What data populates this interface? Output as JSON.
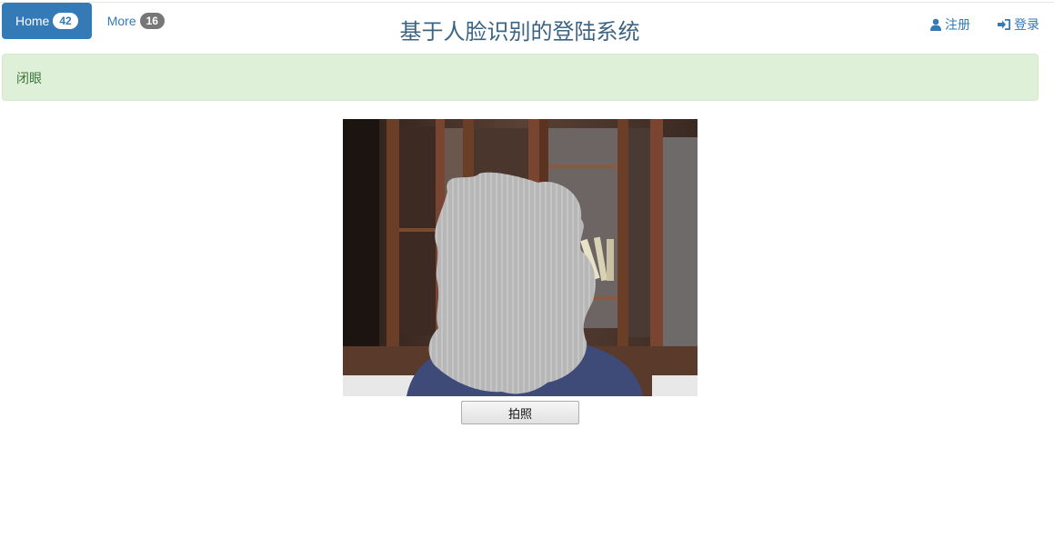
{
  "nav": {
    "items": [
      {
        "label": "Home",
        "badge": "42"
      },
      {
        "label": "More",
        "badge": "16"
      }
    ]
  },
  "header": {
    "title": "基于人脸识别的登陆系统"
  },
  "account_links": {
    "register": "注册",
    "login": "登录"
  },
  "alert": {
    "message": "闭眼"
  },
  "camera": {
    "capture_label": "拍照"
  },
  "icons": {
    "register": "user-icon",
    "login": "log-in-icon"
  },
  "colors": {
    "primary": "#337ab7",
    "title": "#3c6482",
    "alert_bg": "#dff0d8",
    "alert_text": "#3c763d",
    "badge_gray": "#777777"
  }
}
